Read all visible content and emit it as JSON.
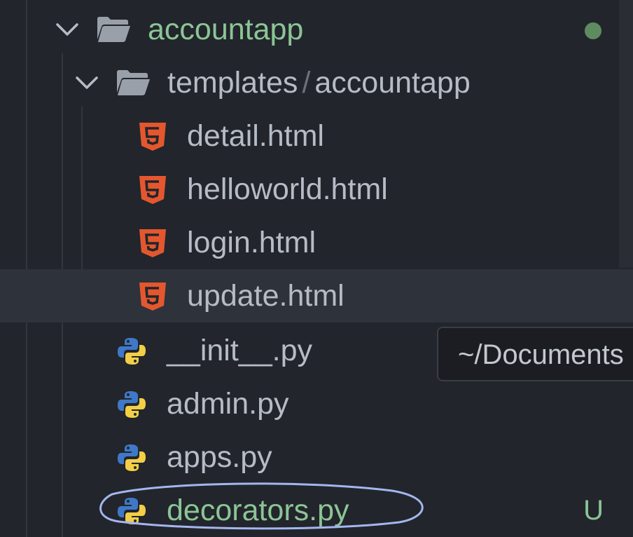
{
  "tree": {
    "root_folder": {
      "name": "accountapp",
      "icon": "folder-open-icon"
    },
    "sub_folder": {
      "name": "templates",
      "sub": "accountapp",
      "separator": "/",
      "icon": "folder-open-icon"
    },
    "html_files": [
      {
        "name": "detail.html",
        "icon": "html5-icon"
      },
      {
        "name": "helloworld.html",
        "icon": "html5-icon"
      },
      {
        "name": "login.html",
        "icon": "html5-icon"
      },
      {
        "name": "update.html",
        "icon": "html5-icon"
      }
    ],
    "py_files": [
      {
        "name": "__init__.py",
        "icon": "python-icon"
      },
      {
        "name": "admin.py",
        "icon": "python-icon"
      },
      {
        "name": "apps.py",
        "icon": "python-icon"
      },
      {
        "name": "decorators.py",
        "icon": "python-icon",
        "badge": "U"
      }
    ]
  },
  "tooltip": {
    "text": "~/Documents"
  },
  "colors": {
    "background": "#22252b",
    "hover_row": "#2e323a",
    "text": "#b6bcc6",
    "untracked_green": "#8cc496",
    "modified_dot": "#5f8b61",
    "html_orange": "#e4572e",
    "python_blue": "#3f78c8",
    "python_yellow": "#f2cf46",
    "annotation_stroke": "#a3b6f0"
  }
}
